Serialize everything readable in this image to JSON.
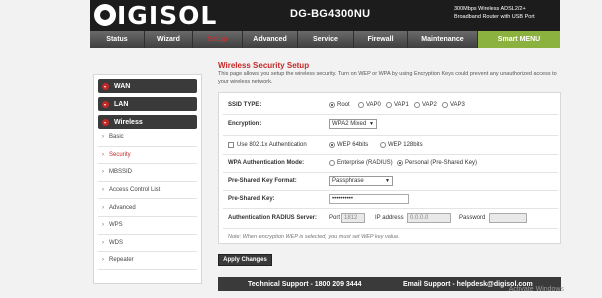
{
  "header": {
    "brand": "DIGISOL",
    "brand_rest": "IGISOL",
    "model": "DG-BG4300NU",
    "tagline": "300Mbps Wireless ADSL2/2+ Broadband Router with USB Port"
  },
  "nav": [
    "Status",
    "Wizard",
    "Setup",
    "Advanced",
    "Service",
    "Firewall",
    "Maintenance",
    "Smart MENU"
  ],
  "sidebar": {
    "heads": [
      "WAN",
      "LAN",
      "Wireless"
    ],
    "items": [
      "Basic",
      "Security",
      "MBSSID",
      "Access Control List",
      "Advanced",
      "WPS",
      "WDS",
      "Repeater"
    ]
  },
  "page": {
    "title": "Wireless Security Setup",
    "description": "This page allows you setup the wireless security. Turn on WEP or WPA by using Encryption Keys could prevent any unauthorized access to your wireless network."
  },
  "form": {
    "ssid_label": "SSID TYPE:",
    "ssid_options": [
      "Root",
      "VAP0",
      "VAP1",
      "VAP2",
      "VAP3"
    ],
    "encryption_label": "Encryption:",
    "encryption_value": "WPA2 Mixed",
    "use8021x_label": "Use 802.1x Authentication",
    "wep64": "WEP 64bits",
    "wep128": "WEP 128bits",
    "wpa_auth_label": "WPA Authentication Mode:",
    "wpa_enterprise": "Enterprise (RADIUS)",
    "wpa_personal": "Personal (Pre-Shared Key)",
    "psk_format_label": "Pre-Shared Key Format:",
    "psk_format_value": "Passphrase",
    "psk_label": "Pre-Shared Key:",
    "psk_value": "••••••••••",
    "radius_label": "Authentication RADIUS Server:",
    "port_label": "Port",
    "port_value": "1812",
    "ip_label": "IP address",
    "ip_value": "0.0.0.0",
    "password_label": "Password",
    "note": "Note: When encryption WEP is selected, you must set WEP key value."
  },
  "apply_label": "Apply Changes",
  "footer": {
    "support": "Technical Support - 1800 209 3444",
    "email": "Email Support - helpdesk@digisol.com"
  },
  "watermark": "Activate Windows",
  "colors": {
    "accent": "#c62828",
    "smart_menu": "#8bb23f",
    "dark": "#3a3a3a"
  }
}
